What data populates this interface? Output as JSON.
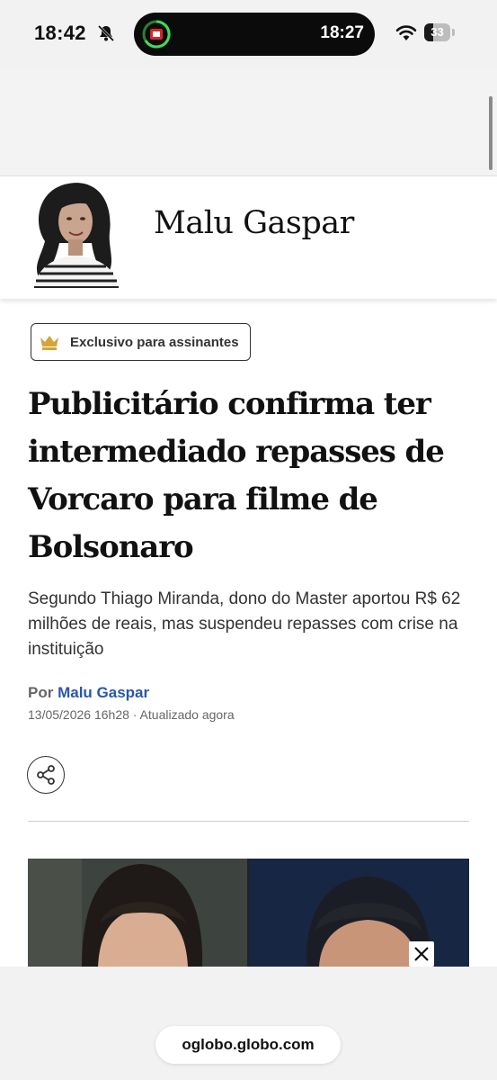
{
  "status_bar": {
    "time": "18:42",
    "live_activity_time": "18:27",
    "battery_level": "33",
    "icons": [
      "bell-slash-icon",
      "wifi-icon",
      "battery-icon",
      "timer-ring-icon"
    ]
  },
  "columnist": {
    "name": "Malu Gaspar"
  },
  "article": {
    "badge": "Exclusivo para assinantes",
    "headline": "Publicitário confirma ter intermediado repasses de Vorcaro para filme de Bolsonaro",
    "subheadline": "Segundo Thiago Miranda, dono do Master aportou R$ 62 milhões de reais, mas suspendeu repasses com crise na instituição",
    "byline_prefix": "Por",
    "author": "Malu Gaspar",
    "dateline": "13/05/2026 16h28 · Atualizado agora"
  },
  "browser": {
    "url": "oglobo.globo.com"
  },
  "colors": {
    "author_link": "#2a57a8",
    "crown": "#d4a437",
    "status_background": "#f2f2f2"
  }
}
